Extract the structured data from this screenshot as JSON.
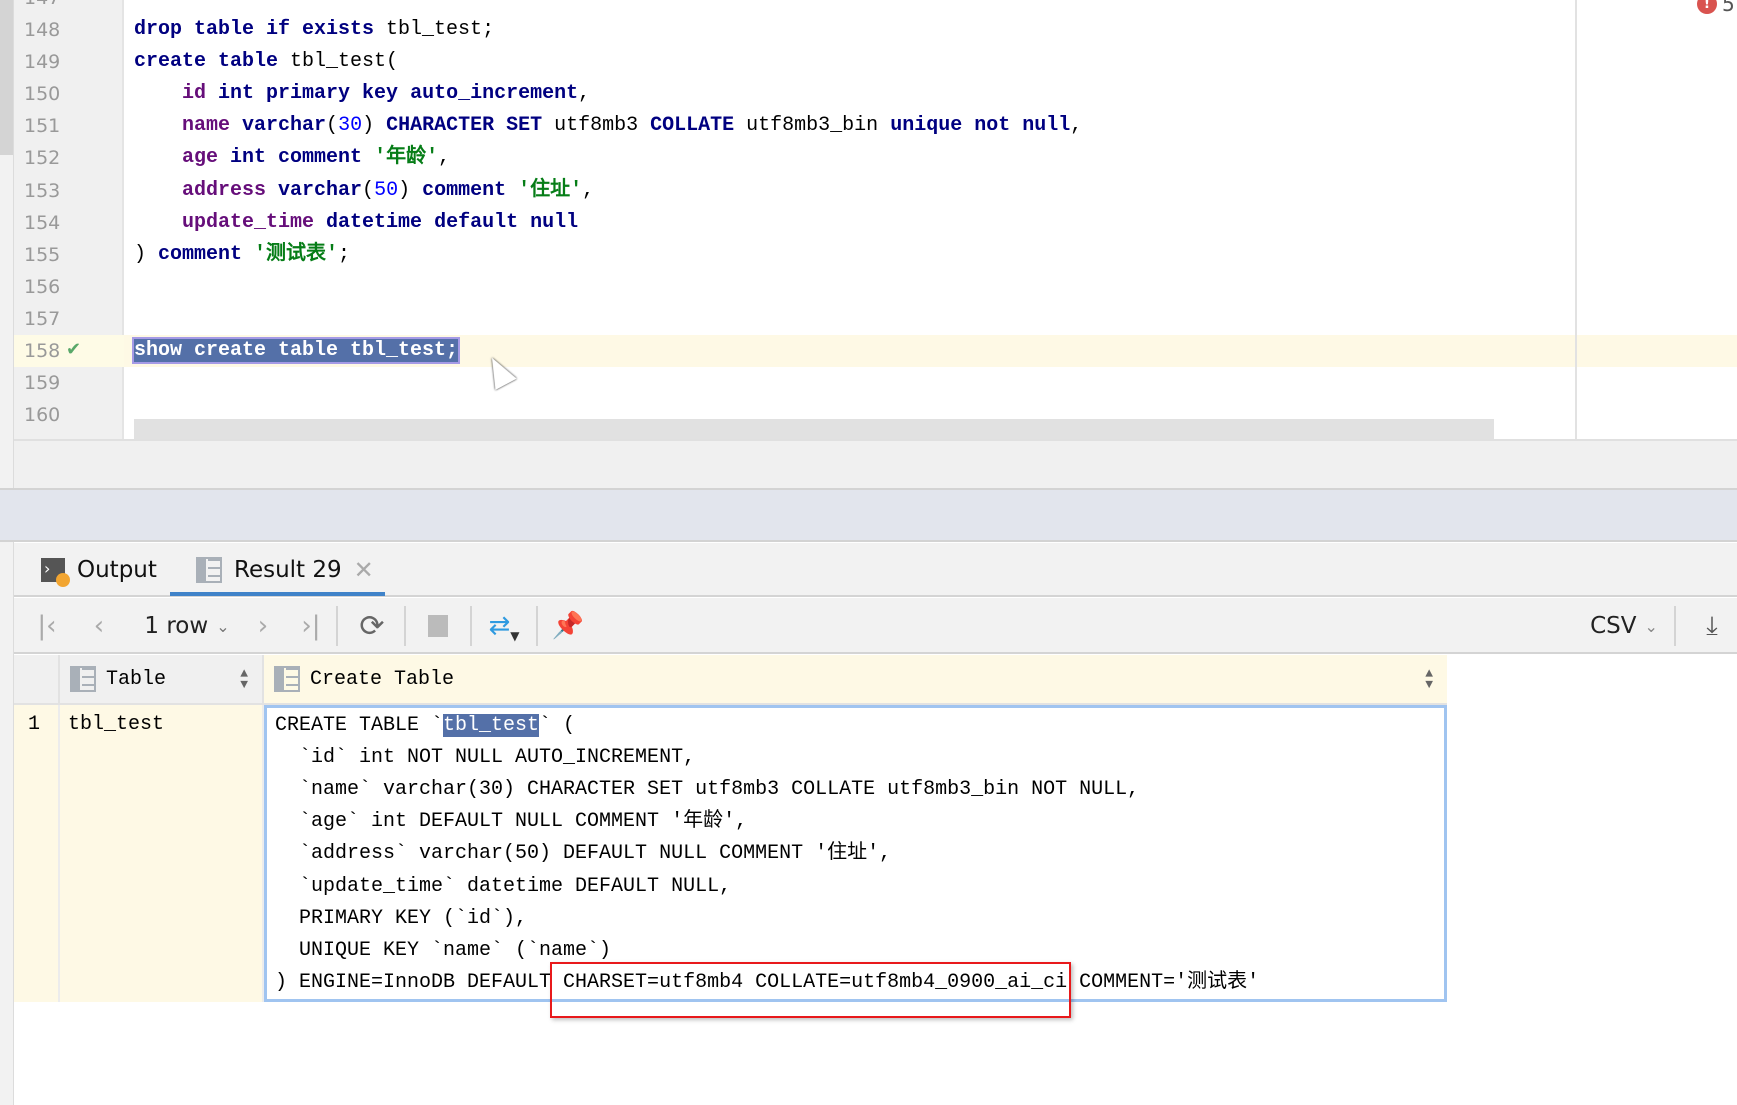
{
  "editor": {
    "first_line_partial": "147",
    "lines": [
      {
        "no": "148",
        "tokens": [
          {
            "t": "drop table if exists ",
            "c": "kw"
          },
          {
            "t": "tbl_test;",
            "c": "plain"
          }
        ]
      },
      {
        "no": "149",
        "fold": "start",
        "tokens": [
          {
            "t": "create table ",
            "c": "kw"
          },
          {
            "t": "tbl_test(",
            "c": "plain"
          }
        ]
      },
      {
        "no": "150",
        "tokens": [
          {
            "t": "    ",
            "c": "plain"
          },
          {
            "t": "id ",
            "c": "col"
          },
          {
            "t": "int primary key auto_increment",
            "c": "kw"
          },
          {
            "t": ",",
            "c": "plain"
          }
        ]
      },
      {
        "no": "151",
        "tokens": [
          {
            "t": "    ",
            "c": "plain"
          },
          {
            "t": "name ",
            "c": "col"
          },
          {
            "t": "varchar",
            "c": "kw"
          },
          {
            "t": "(",
            "c": "plain"
          },
          {
            "t": "30",
            "c": "num"
          },
          {
            "t": ") ",
            "c": "plain"
          },
          {
            "t": "CHARACTER SET ",
            "c": "kw"
          },
          {
            "t": "utf8mb3 ",
            "c": "plain"
          },
          {
            "t": "COLLATE ",
            "c": "kw"
          },
          {
            "t": "utf8mb3_bin ",
            "c": "plain"
          },
          {
            "t": "unique not null",
            "c": "kw"
          },
          {
            "t": ",",
            "c": "plain"
          }
        ]
      },
      {
        "no": "152",
        "tokens": [
          {
            "t": "    ",
            "c": "plain"
          },
          {
            "t": "age ",
            "c": "col"
          },
          {
            "t": "int comment ",
            "c": "kw"
          },
          {
            "t": "'年龄'",
            "c": "str"
          },
          {
            "t": ",",
            "c": "plain"
          }
        ]
      },
      {
        "no": "153",
        "tokens": [
          {
            "t": "    ",
            "c": "plain"
          },
          {
            "t": "address ",
            "c": "col"
          },
          {
            "t": "varchar",
            "c": "kw"
          },
          {
            "t": "(",
            "c": "plain"
          },
          {
            "t": "50",
            "c": "num"
          },
          {
            "t": ") ",
            "c": "plain"
          },
          {
            "t": "comment ",
            "c": "kw"
          },
          {
            "t": "'住址'",
            "c": "str"
          },
          {
            "t": ",",
            "c": "plain"
          }
        ]
      },
      {
        "no": "154",
        "tokens": [
          {
            "t": "    ",
            "c": "plain"
          },
          {
            "t": "update_time ",
            "c": "col"
          },
          {
            "t": "datetime default null",
            "c": "kw"
          }
        ]
      },
      {
        "no": "155",
        "fold": "end",
        "tokens": [
          {
            "t": ") ",
            "c": "plain"
          },
          {
            "t": "comment ",
            "c": "kw"
          },
          {
            "t": "'测试表'",
            "c": "str"
          },
          {
            "t": ";",
            "c": "plain"
          }
        ]
      },
      {
        "no": "156",
        "tokens": []
      },
      {
        "no": "157",
        "tokens": []
      },
      {
        "no": "158",
        "current": true,
        "executed": true,
        "tokens": [
          {
            "t": "show create table tbl_test;",
            "c": "kw sel"
          }
        ]
      },
      {
        "no": "159",
        "tokens": []
      },
      {
        "no": "160",
        "tokens": []
      }
    ],
    "problems_count": "5"
  },
  "tabs": [
    {
      "label": "Output",
      "icon": "console-output-icon",
      "active": false
    },
    {
      "label": "Result 29",
      "icon": "table-icon",
      "active": true,
      "closable": true
    }
  ],
  "toolbar": {
    "rows_label": "1 row",
    "format_label": "CSV"
  },
  "grid": {
    "columns": [
      "Table",
      "Create Table"
    ],
    "rows": [
      {
        "num": "1",
        "table": "tbl_test",
        "create_table": [
          "CREATE TABLE `tbl_test` (",
          "  `id` int NOT NULL AUTO_INCREMENT,",
          "  `name` varchar(30) CHARACTER SET utf8mb3 COLLATE utf8mb3_bin NOT NULL,",
          "  `age` int DEFAULT NULL COMMENT '年龄',",
          "  `address` varchar(50) DEFAULT NULL COMMENT '住址',",
          "  `update_time` datetime DEFAULT NULL,",
          "  PRIMARY KEY (`id`),",
          "  UNIQUE KEY `name` (`name`)",
          ") ENGINE=InnoDB DEFAULT CHARSET=utf8mb4 COLLATE=utf8mb4_0900_ai_ci COMMENT='测试表'"
        ]
      }
    ]
  },
  "colors": {
    "keyword": "#000080",
    "column": "#660e7a",
    "number": "#0000ff",
    "string": "#067d17",
    "selection": "#5470a8",
    "caret_row": "#fef9e5",
    "tab_underline": "#4083c9",
    "annotation_box": "#e8191b"
  }
}
